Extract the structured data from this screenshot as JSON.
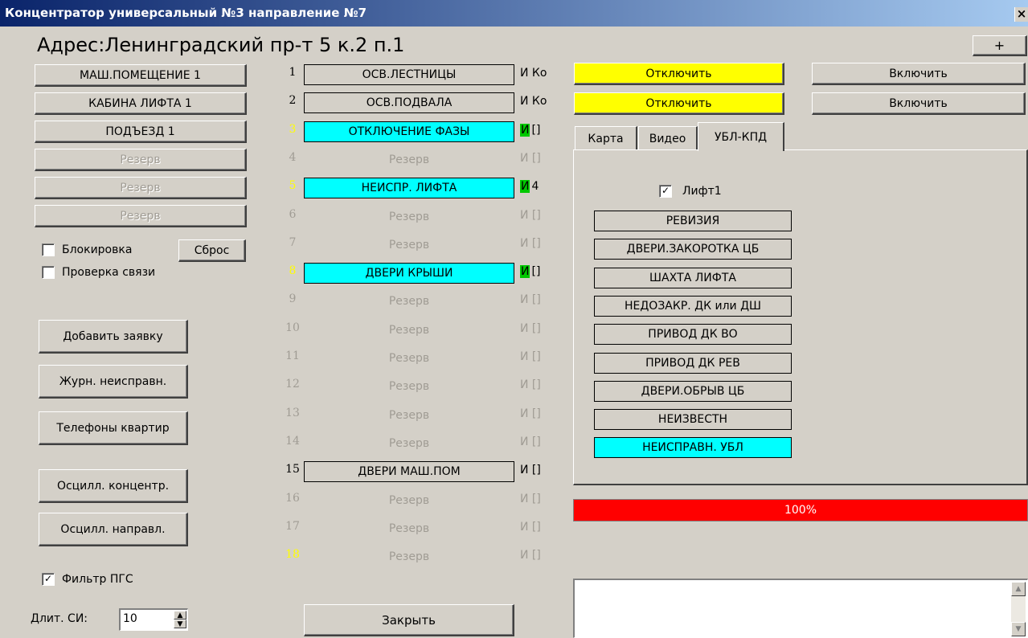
{
  "window": {
    "title": "Концентратор универсальный №3 направление №7",
    "close": "×"
  },
  "address": "Адрес:Ленинградский пр-т 5 к.2 п.1",
  "plus_button": "+",
  "zones": [
    {
      "label": "МАШ.ПОМЕЩЕНИЕ 1",
      "enabled": true
    },
    {
      "label": "КАБИНА ЛИФТА 1",
      "enabled": true
    },
    {
      "label": "ПОДЪЕЗД 1",
      "enabled": true
    },
    {
      "label": "Резерв",
      "enabled": false
    },
    {
      "label": "Резерв",
      "enabled": false
    },
    {
      "label": "Резерв",
      "enabled": false
    }
  ],
  "block_checkbox": {
    "label": "Блокировка",
    "checked": false
  },
  "reset_button": "Сброс",
  "link_check_checkbox": {
    "label": "Проверка связи",
    "checked": false
  },
  "actions": [
    "Добавить заявку",
    "Журн. неисправн.",
    "Телефоны квартир",
    "Осцилл. концентр.",
    "Осцилл. направл."
  ],
  "pgs_filter_checkbox": {
    "label": "Фильтр ПГС",
    "checked": true
  },
  "duration": {
    "label": "Длит. СИ:",
    "value": "10"
  },
  "signals": [
    {
      "num": "1",
      "label": "ОСВ.ЛЕСТНИЦЫ",
      "ind": "И Ко",
      "state": "normal",
      "num_color": "#000000"
    },
    {
      "num": "2",
      "label": "ОСВ.ПОДВАЛА",
      "ind": "И Ко",
      "state": "normal",
      "num_color": "#000000"
    },
    {
      "num": "3",
      "label": "ОТКЛЮЧЕНИЕ ФАЗЫ",
      "ind_i": "И",
      "ind_rest": "[]",
      "state": "alarm",
      "num_color": "#ffff00"
    },
    {
      "num": "4",
      "label": "Резерв",
      "ind": "И []",
      "state": "reserve",
      "num_color": "#a09c94"
    },
    {
      "num": "5",
      "label": "НЕИСПР. ЛИФТА",
      "ind_i": "И",
      "ind_rest": "4",
      "state": "alarm",
      "num_color": "#ffff00"
    },
    {
      "num": "6",
      "label": "Резерв",
      "ind": "И []",
      "state": "reserve",
      "num_color": "#a09c94"
    },
    {
      "num": "7",
      "label": "Резерв",
      "ind": "И []",
      "state": "reserve",
      "num_color": "#a09c94"
    },
    {
      "num": "8",
      "label": "ДВЕРИ КРЫШИ",
      "ind_i": "И",
      "ind_rest": "[]",
      "state": "alarm",
      "num_color": "#ffff00"
    },
    {
      "num": "9",
      "label": "Резерв",
      "ind": "И []",
      "state": "reserve",
      "num_color": "#a09c94"
    },
    {
      "num": "10",
      "label": "Резерв",
      "ind": "И []",
      "state": "reserve",
      "num_color": "#a09c94"
    },
    {
      "num": "11",
      "label": "Резерв",
      "ind": "И []",
      "state": "reserve",
      "num_color": "#a09c94"
    },
    {
      "num": "12",
      "label": "Резерв",
      "ind": "И []",
      "state": "reserve",
      "num_color": "#a09c94"
    },
    {
      "num": "13",
      "label": "Резерв",
      "ind": "И []",
      "state": "reserve",
      "num_color": "#a09c94"
    },
    {
      "num": "14",
      "label": "Резерв",
      "ind": "И []",
      "state": "reserve",
      "num_color": "#a09c94"
    },
    {
      "num": "15",
      "label": "ДВЕРИ МАШ.ПОМ",
      "ind": "И []",
      "state": "normal",
      "num_color": "#000000"
    },
    {
      "num": "16",
      "label": "Резерв",
      "ind": "И []",
      "state": "reserve",
      "num_color": "#a09c94"
    },
    {
      "num": "17",
      "label": "Резерв",
      "ind": "И []",
      "state": "reserve",
      "num_color": "#a09c94"
    },
    {
      "num": "18",
      "label": "Резерв",
      "ind": "И []",
      "state": "reserve",
      "num_color": "#ffff00"
    }
  ],
  "close_button": "Закрыть",
  "power_rows": [
    {
      "off": "Отключить",
      "on": "Включить"
    },
    {
      "off": "Отключить",
      "on": "Включить"
    }
  ],
  "tabs": [
    {
      "label": "Карта",
      "active": false
    },
    {
      "label": "Видео",
      "active": false
    },
    {
      "label": "УБЛ-КПД",
      "active": true
    }
  ],
  "lift_checkbox": {
    "label": "Лифт1",
    "checked": true
  },
  "ubl_items": [
    {
      "label": "РЕВИЗИЯ",
      "alarm": false
    },
    {
      "label": "ДВЕРИ.ЗАКОРОТКА ЦБ",
      "alarm": false
    },
    {
      "label": "ШАХТА ЛИФТА",
      "alarm": false
    },
    {
      "label": "НЕДОЗАКР. ДК или ДШ",
      "alarm": false
    },
    {
      "label": "ПРИВОД ДК ВО",
      "alarm": false
    },
    {
      "label": "ПРИВОД ДК РЕВ",
      "alarm": false
    },
    {
      "label": "ДВЕРИ.ОБРЫВ ЦБ",
      "alarm": false
    },
    {
      "label": "НЕИЗВЕСТН",
      "alarm": false
    },
    {
      "label": "НЕИСПРАВН. УБЛ",
      "alarm": true
    }
  ],
  "progress": {
    "value": 100,
    "label": "100%"
  },
  "colors": {
    "alarm": "#00ffff",
    "off_button": "#ffff00",
    "progress": "#ff0000",
    "indicator_green": "#00c800"
  }
}
